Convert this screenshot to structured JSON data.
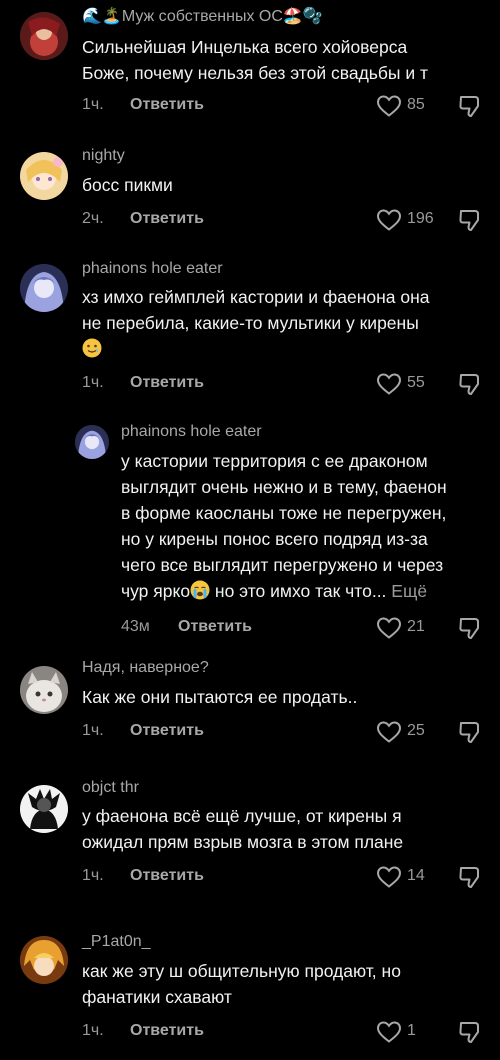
{
  "comments": [
    {
      "username": "🌊🏝️Муж собственных ОС🏖️🫧",
      "lines": [
        "Сильнейшая Инцелька всего хойоверса",
        "Боже, почему нельзя без этой свадьбы и т"
      ],
      "time": "1ч.",
      "reply": "Ответить",
      "likes": "85",
      "avatar_colors": [
        "#5a1a1a",
        "#c2403a",
        "#e8c0a0"
      ]
    },
    {
      "username": "nighty",
      "lines": [
        "босс пикми"
      ],
      "time": "2ч.",
      "reply": "Ответить",
      "likes": "196",
      "avatar_colors": [
        "#f3d7a0",
        "#f7b8c8",
        "#8c6bb1"
      ]
    },
    {
      "username": "phainons hole eater",
      "lines": [
        "хз имхо геймплей кастории и фаенона она",
        "не перебила, какие-то мультики у кирены"
      ],
      "emoji_line": "🥲",
      "time": "1ч.",
      "reply": "Ответить",
      "likes": "55",
      "avatar_colors": [
        "#2b2f55",
        "#9aa3e0",
        "#e8e8f8"
      ]
    },
    {
      "username": "phainons hole eater",
      "lines": [
        "у кастории территория с ее драконом",
        "выглядит очень нежно и в тему, фаенон",
        "в форме каосланы тоже не перегружен,",
        "но у кирены понос всего подряд из-за",
        "чего все выглядит перегружено и через"
      ],
      "last_line_before": "чур ярко",
      "last_line_emoji": "😭",
      "last_line_after": " но это имхо так что...",
      "more": "Ещё",
      "time": "43м",
      "reply": "Ответить",
      "likes": "21",
      "avatar_colors": [
        "#2b2f55",
        "#9aa3e0",
        "#e8e8f8"
      ]
    },
    {
      "username": "Надя, наверное?",
      "lines": [
        "Как же они пытаются ее продать.."
      ],
      "time": "1ч.",
      "reply": "Ответить",
      "likes": "25",
      "avatar_colors": [
        "#d9d4cf",
        "#8a8580",
        "#3a3633"
      ]
    },
    {
      "username": "objct thr",
      "lines": [
        "у фаенона всё ещё лучше, от кирены я",
        "ожидал прям взрыв мозга в этом плане"
      ],
      "time": "1ч.",
      "reply": "Ответить",
      "likes": "14",
      "avatar_colors": [
        "#f2f2f2",
        "#111111",
        "#555555"
      ]
    },
    {
      "username": "_P1at0n_",
      "lines": [
        "как же эту ш общительную продают, но",
        "фанатики схавают"
      ],
      "time": "1ч.",
      "reply": "Ответить",
      "likes": "1",
      "avatar_colors": [
        "#e8a030",
        "#f5d060",
        "#7a3a10"
      ]
    }
  ]
}
